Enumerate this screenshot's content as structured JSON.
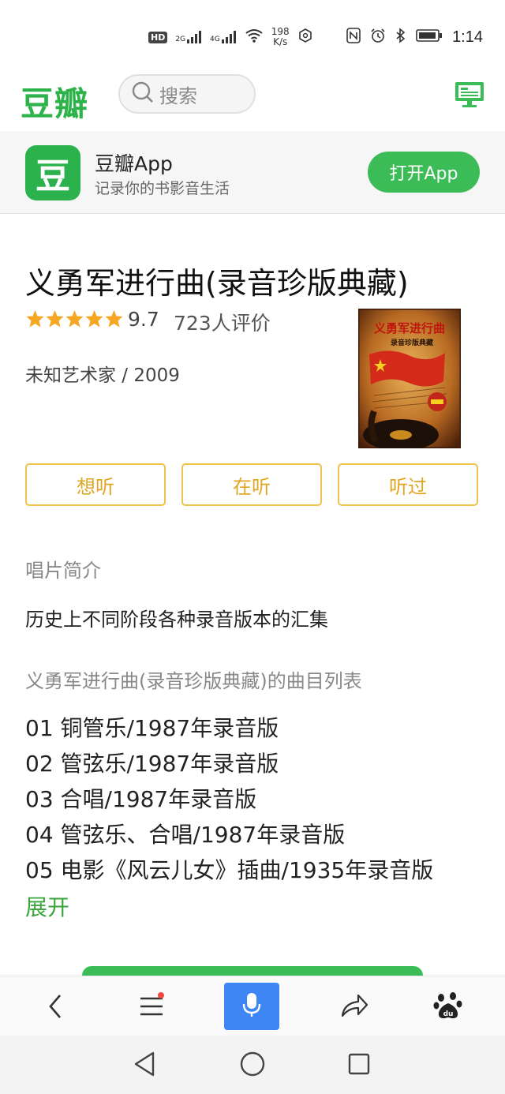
{
  "status_bar": {
    "hd": "HD",
    "net1": "2G",
    "net2": "4G",
    "speed_value": "198",
    "speed_unit": "K/s",
    "time": "1:14"
  },
  "header": {
    "logo": "豆瓣",
    "search_placeholder": "搜索"
  },
  "app_banner": {
    "icon_char": "豆",
    "name": "豆瓣App",
    "subtitle": "记录你的书影音生活",
    "open_button": "打开App"
  },
  "album": {
    "title": "义勇军进行曲(录音珍版典藏)",
    "stars": 5,
    "rating": "9.7",
    "votes": "723人评价",
    "artist_year": "未知艺术家 / 2009",
    "cover": {
      "title": "义勇军进行曲",
      "subtitle": "录音珍版典藏"
    }
  },
  "actions": {
    "want": "想听",
    "listening": "在听",
    "listened": "听过"
  },
  "intro": {
    "heading": "唱片简介",
    "text": "历史上不同阶段各种录音版本的汇集"
  },
  "tracks": {
    "heading": "义勇军进行曲(录音珍版典藏)的曲目列表",
    "items": [
      "01 铜管乐/1987年录音版",
      "02 管弦乐/1987年录音版",
      "03 合唱/1987年录音版",
      "04 管弦乐、合唱/1987年录音版",
      "05 电影《风云儿女》插曲/1935年录音版"
    ],
    "expand": "展开"
  },
  "colors": {
    "brand_green": "#2db34a",
    "button_green": "#3cbc57",
    "star": "#f5a623",
    "action_border": "#f0c14b",
    "mic_blue": "#3f86f5"
  }
}
